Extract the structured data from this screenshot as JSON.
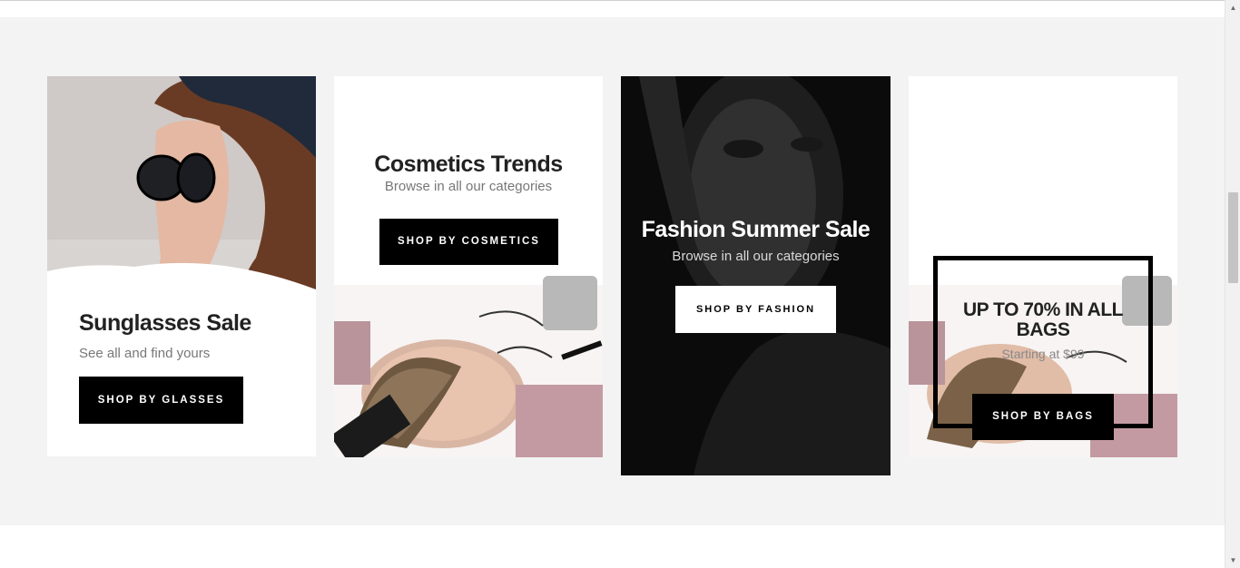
{
  "cards": [
    {
      "title": "Sunglasses Sale",
      "subtitle": "See all and find yours",
      "button_label": "SHOP BY GLASSES"
    },
    {
      "title": "Cosmetics Trends",
      "subtitle": "Browse in all our categories",
      "button_label": "SHOP BY COSMETICS"
    },
    {
      "title": "Fashion Summer Sale",
      "subtitle": "Browse in all our categories",
      "button_label": "SHOP BY FASHION"
    },
    {
      "title": "UP TO 70% IN ALL BAGS",
      "subtitle": "Starting at $99",
      "button_label": "SHOP BY BAGS"
    }
  ],
  "colors": {
    "section_bg": "#f3f3f3",
    "button_bg": "#000000",
    "button_text": "#ffffff",
    "dark_card_bg": "#161616"
  },
  "icons": {
    "scroll_up": "scroll-up-arrow-icon",
    "scroll_down": "scroll-down-arrow-icon"
  }
}
